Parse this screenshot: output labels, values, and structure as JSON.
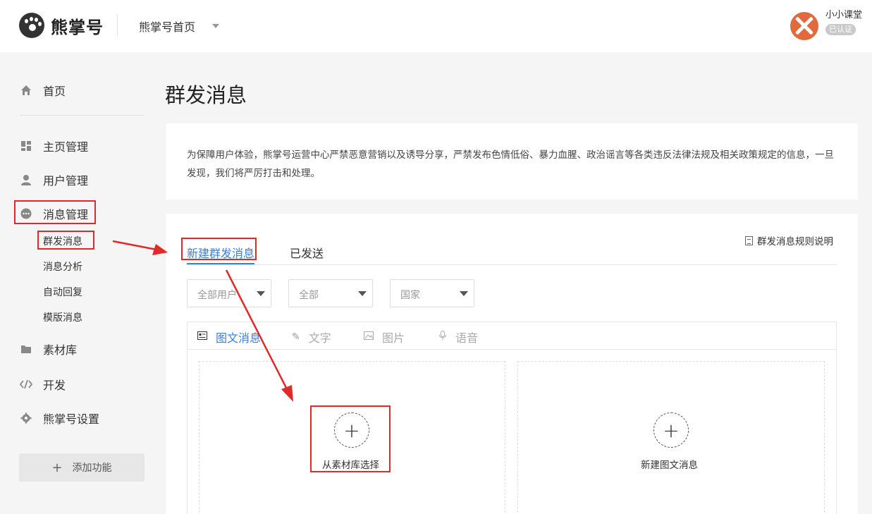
{
  "header": {
    "logo_text": "熊掌号",
    "nav_label": "熊掌号首页",
    "user_name": "小小课堂",
    "user_badge": "已认证"
  },
  "sidebar": {
    "items": [
      {
        "label": "首页",
        "icon": "home-icon"
      },
      {
        "label": "主页管理",
        "icon": "dashboard-icon"
      },
      {
        "label": "用户管理",
        "icon": "user-icon"
      },
      {
        "label": "消息管理",
        "icon": "chat-bubble-icon"
      },
      {
        "label": "素材库",
        "icon": "folder-icon"
      },
      {
        "label": "开发",
        "icon": "code-icon"
      },
      {
        "label": "熊掌号设置",
        "icon": "gear-icon"
      }
    ],
    "sub_items": [
      "群发消息",
      "消息分析",
      "自动回复",
      "模版消息"
    ],
    "add_label": "添加功能"
  },
  "main": {
    "title": "群发消息",
    "notice": "为保障用户体验，熊掌号运营中心严禁恶意营销以及诱导分享，严禁发布色情低俗、暴力血腥、政治谣言等各类违反法律法规及相关政策规定的信息，一旦发现，我们将严厉打击和处理。",
    "tabs": [
      "新建群发消息",
      "已发送"
    ],
    "rules_link": "群发消息规则说明",
    "filters": [
      "全部用户",
      "全部",
      "国家"
    ],
    "type_tabs": [
      "图文消息",
      "文字",
      "图片",
      "语音"
    ],
    "cards": [
      "从素材库选择",
      "新建图文消息"
    ]
  },
  "colors": {
    "accent": "#3b7ee0",
    "highlight": "#e02a2a",
    "avatar": "#e06a3d"
  }
}
